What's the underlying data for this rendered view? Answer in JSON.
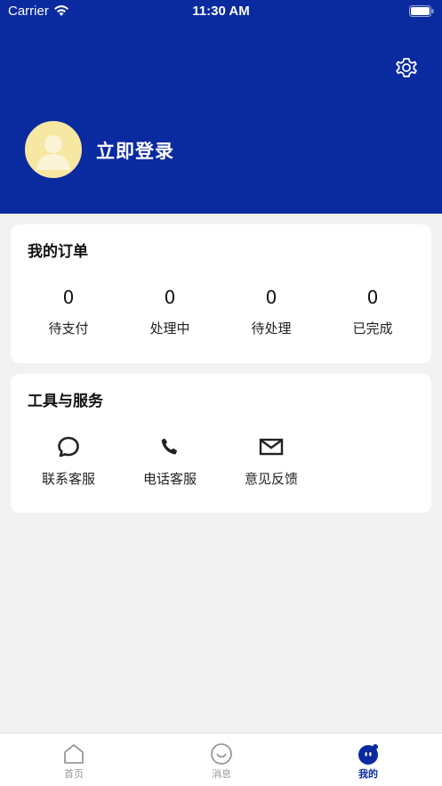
{
  "status_bar": {
    "carrier": "Carrier",
    "time": "11:30 AM"
  },
  "header": {
    "login_label": "立即登录",
    "bg_color": "#0a2aa0",
    "avatar_color": "#f6e7a2",
    "settings_icon": "gear-icon"
  },
  "orders": {
    "title": "我的订单",
    "items": [
      {
        "value": "0",
        "label": "待支付"
      },
      {
        "value": "0",
        "label": "处理中"
      },
      {
        "value": "0",
        "label": "待处理"
      },
      {
        "value": "0",
        "label": "已完成"
      }
    ]
  },
  "tools": {
    "title": "工具与服务",
    "items": [
      {
        "label": "联系客服",
        "icon": "chat-bubble-icon"
      },
      {
        "label": "电话客服",
        "icon": "phone-icon"
      },
      {
        "label": "意见反馈",
        "icon": "mail-icon"
      }
    ]
  },
  "tabbar": {
    "active_color": "#0a2aa0",
    "tabs": [
      {
        "label": "首页",
        "icon": "home-icon"
      },
      {
        "label": "消息",
        "icon": "message-icon"
      },
      {
        "label": "我的",
        "icon": "profile-icon",
        "active": true
      }
    ]
  }
}
